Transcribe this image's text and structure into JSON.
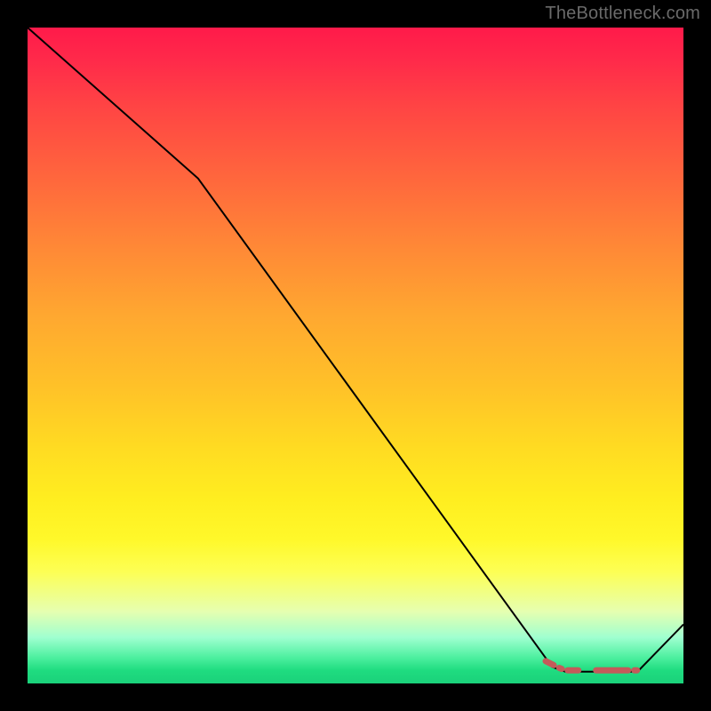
{
  "watermark": "TheBottleneck.com",
  "chart_data": {
    "type": "line",
    "title": "",
    "xlabel": "",
    "ylabel": "",
    "xlim": [
      0,
      100
    ],
    "ylim": [
      0,
      100
    ],
    "series": [
      {
        "name": "curve",
        "stroke": "#000000",
        "stroke_width": 2,
        "points": [
          {
            "x": 0,
            "y": 100
          },
          {
            "x": 26,
            "y": 77
          },
          {
            "x": 80,
            "y": 2.5
          },
          {
            "x": 82,
            "y": 1.8
          },
          {
            "x": 93,
            "y": 1.8
          },
          {
            "x": 100,
            "y": 9
          }
        ]
      },
      {
        "name": "flat-marker",
        "stroke": "#c45a5a",
        "stroke_width": 7,
        "linecap": "round",
        "dash": [
          10,
          7,
          3,
          7,
          12,
          20,
          26,
          0
        ],
        "points": [
          {
            "x": 79,
            "y": 3.4
          },
          {
            "x": 81,
            "y": 2.4
          },
          {
            "x": 82,
            "y": 2.0
          },
          {
            "x": 93,
            "y": 2.0
          }
        ]
      }
    ],
    "gradient_colors": {
      "top": "#ff1a4a",
      "mid_upper": "#ff8a36",
      "mid": "#ffee20",
      "mid_lower": "#fdff55",
      "bottom": "#1ad17a"
    }
  }
}
